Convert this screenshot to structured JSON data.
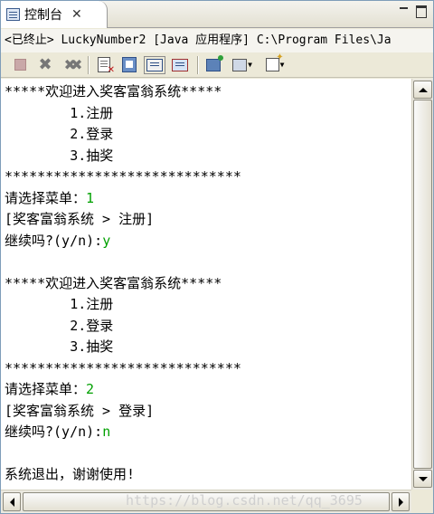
{
  "tab": {
    "label": "控制台",
    "close_glyph": "✕"
  },
  "description": "<已终止> LuckyNumber2 [Java 应用程序] C:\\Program Files\\Ja",
  "toolbar": {
    "icons": [
      "terminate-icon",
      "remove-launch-icon",
      "remove-all-terminated-icon",
      "clear-console-icon",
      "scroll-lock-icon",
      "show-on-stdout-icon",
      "show-on-stderr-icon",
      "pin-console-icon",
      "display-selected-console-icon",
      "open-console-icon"
    ]
  },
  "console": {
    "output_color": "#000000",
    "input_color": "#00a000",
    "lines": [
      {
        "text": "*****欢迎进入奖客富翁系统*****",
        "input": ""
      },
      {
        "text": "        1.注册",
        "input": ""
      },
      {
        "text": "        2.登录",
        "input": ""
      },
      {
        "text": "        3.抽奖",
        "input": ""
      },
      {
        "text": "*****************************",
        "input": ""
      },
      {
        "text": "请选择菜单：",
        "input": "1"
      },
      {
        "text": "[奖客富翁系统 > 注册]",
        "input": ""
      },
      {
        "text": "继续吗?(y/n):",
        "input": "y"
      },
      {
        "text": "",
        "input": ""
      },
      {
        "text": "*****欢迎进入奖客富翁系统*****",
        "input": ""
      },
      {
        "text": "        1.注册",
        "input": ""
      },
      {
        "text": "        2.登录",
        "input": ""
      },
      {
        "text": "        3.抽奖",
        "input": ""
      },
      {
        "text": "*****************************",
        "input": ""
      },
      {
        "text": "请选择菜单：",
        "input": "2"
      },
      {
        "text": "[奖客富翁系统 > 登录]",
        "input": ""
      },
      {
        "text": "继续吗?(y/n):",
        "input": "n"
      },
      {
        "text": "",
        "input": ""
      },
      {
        "text": "系统退出，谢谢使用!",
        "input": ""
      }
    ]
  },
  "watermark": "https://blog.csdn.net/qq_3695"
}
